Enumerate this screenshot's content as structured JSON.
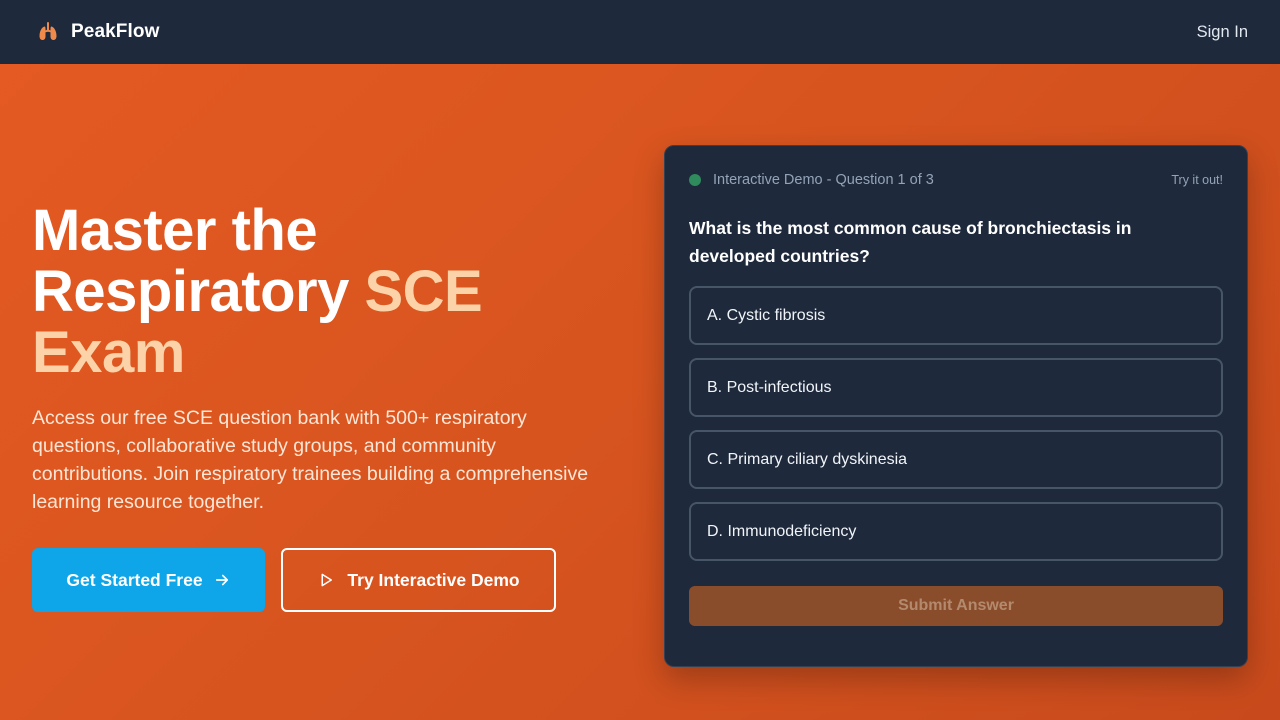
{
  "nav": {
    "brand": "PeakFlow",
    "sign_in": "Sign In"
  },
  "hero": {
    "title_line1": "Master the",
    "title_line2_prefix": "Respiratory ",
    "title_accent": "SCE",
    "title_line3": "Exam",
    "description": "Access our free SCE question bank with 500+ respiratory questions, collaborative study groups, and community contributions. Join respiratory trainees building a comprehensive learning resource together.",
    "primary_button": "Get Started Free",
    "secondary_button": "Try Interactive Demo"
  },
  "demo": {
    "status_label": "Interactive Demo - Question 1 of 3",
    "hint": "Try it out!",
    "question": "What is the most common cause of bronchiectasis in developed countries?",
    "options": [
      "A. Cystic fibrosis",
      "B. Post-infectious",
      "C. Primary ciliary dyskinesia",
      "D. Immunodeficiency"
    ],
    "submit": "Submit Answer"
  },
  "colors": {
    "accent_orange": "#e55a22",
    "navbar": "#1e293b",
    "primary_button": "#0ea5e9",
    "title_accent": "#fcd3a8",
    "status_dot": "#2f8a5c"
  },
  "icons": {
    "brand": "lungs-icon",
    "primary_button": "arrow-right-icon",
    "secondary_button": "play-icon"
  }
}
